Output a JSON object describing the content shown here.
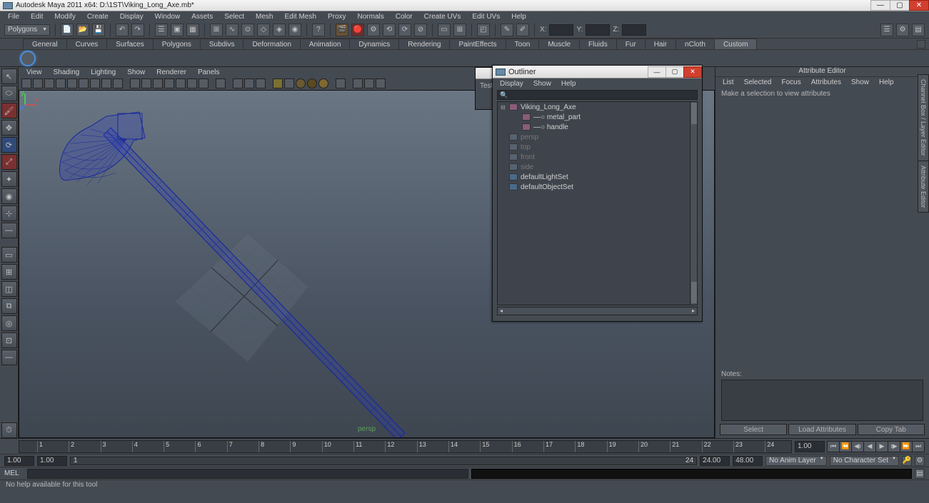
{
  "title": "Autodesk Maya 2011 x64: D:\\1ST\\Viking_Long_Axe.mb*",
  "mainMenu": [
    "File",
    "Edit",
    "Modify",
    "Create",
    "Display",
    "Window",
    "Assets",
    "Select",
    "Mesh",
    "Edit Mesh",
    "Proxy",
    "Normals",
    "Color",
    "Create UVs",
    "Edit UVs",
    "Help"
  ],
  "moduleCombo": "Polygons",
  "coordX_label": "X:",
  "coordY_label": "Y:",
  "coordZ_label": "Z:",
  "tabs": [
    "General",
    "Curves",
    "Surfaces",
    "Polygons",
    "Subdivs",
    "Deformation",
    "Animation",
    "Dynamics",
    "Rendering",
    "PaintEffects",
    "Toon",
    "Muscle",
    "Fluids",
    "Fur",
    "Hair",
    "nCloth",
    "Custom"
  ],
  "activeTab": "Custom",
  "panelMenu": [
    "View",
    "Shading",
    "Lighting",
    "Show",
    "Renderer",
    "Panels"
  ],
  "persp": "persp",
  "attr": {
    "title": "Attribute Editor",
    "menu": [
      "List",
      "Selected",
      "Focus",
      "Attributes",
      "Show",
      "Help"
    ],
    "msg": "Make a selection to view attributes",
    "notes": "Notes:",
    "btns": [
      "Select",
      "Load Attributes",
      "Copy Tab"
    ],
    "sideTabs": [
      "Channel Box / Layer Editor",
      "Attribute Editor"
    ]
  },
  "outliner": {
    "title": "Outliner",
    "menu": [
      "Display",
      "Show",
      "Help"
    ],
    "items": [
      {
        "exp": "⊟",
        "icon": "mesh",
        "label": "Viking_Long_Axe",
        "indent": 0,
        "dim": false
      },
      {
        "exp": "",
        "icon": "mesh",
        "label": "metal_part",
        "indent": 1,
        "dim": false,
        "conn": true
      },
      {
        "exp": "",
        "icon": "mesh",
        "label": "handle",
        "indent": 1,
        "dim": false,
        "conn": true
      },
      {
        "exp": "",
        "icon": "cam",
        "label": "persp",
        "indent": 0,
        "dim": true
      },
      {
        "exp": "",
        "icon": "cam",
        "label": "top",
        "indent": 0,
        "dim": true
      },
      {
        "exp": "",
        "icon": "cam",
        "label": "front",
        "indent": 0,
        "dim": true
      },
      {
        "exp": "",
        "icon": "cam",
        "label": "side",
        "indent": 0,
        "dim": true
      },
      {
        "exp": "",
        "icon": "set",
        "label": "defaultLightSet",
        "indent": 0,
        "dim": false
      },
      {
        "exp": "",
        "icon": "set",
        "label": "defaultObjectSet",
        "indent": 0,
        "dim": false
      }
    ]
  },
  "ghostWin": {
    "tab": "Test"
  },
  "timeline": {
    "start": "1",
    "visStart": "1",
    "end": "24",
    "frameField": "1.00",
    "rangeStart": "1.00",
    "rangeVisStart": "1.00",
    "rangeEnd": "24.00",
    "rangeVisEnd": "48.00",
    "animLayer": "No Anim Layer",
    "charSet": "No Character Set"
  },
  "ticks": [
    {
      "p": 2.3,
      "v": "1"
    },
    {
      "p": 6.4,
      "v": "2"
    },
    {
      "p": 10.5,
      "v": "3"
    },
    {
      "p": 14.6,
      "v": "4"
    },
    {
      "p": 18.7,
      "v": "5"
    },
    {
      "p": 22.8,
      "v": "6"
    },
    {
      "p": 26.9,
      "v": "7"
    },
    {
      "p": 31.0,
      "v": "8"
    },
    {
      "p": 35.1,
      "v": "9"
    },
    {
      "p": 39.2,
      "v": "10"
    },
    {
      "p": 43.3,
      "v": "11"
    },
    {
      "p": 47.4,
      "v": "12"
    },
    {
      "p": 51.5,
      "v": "13"
    },
    {
      "p": 55.6,
      "v": "14"
    },
    {
      "p": 59.7,
      "v": "15"
    },
    {
      "p": 63.8,
      "v": "16"
    },
    {
      "p": 67.9,
      "v": "17"
    },
    {
      "p": 72.0,
      "v": "18"
    },
    {
      "p": 76.1,
      "v": "19"
    },
    {
      "p": 80.2,
      "v": "20"
    },
    {
      "p": 84.3,
      "v": "21"
    },
    {
      "p": 88.4,
      "v": "22"
    },
    {
      "p": 92.5,
      "v": "23"
    },
    {
      "p": 96.6,
      "v": "24"
    }
  ],
  "mel": "MEL",
  "helpText": "No help available for this tool"
}
